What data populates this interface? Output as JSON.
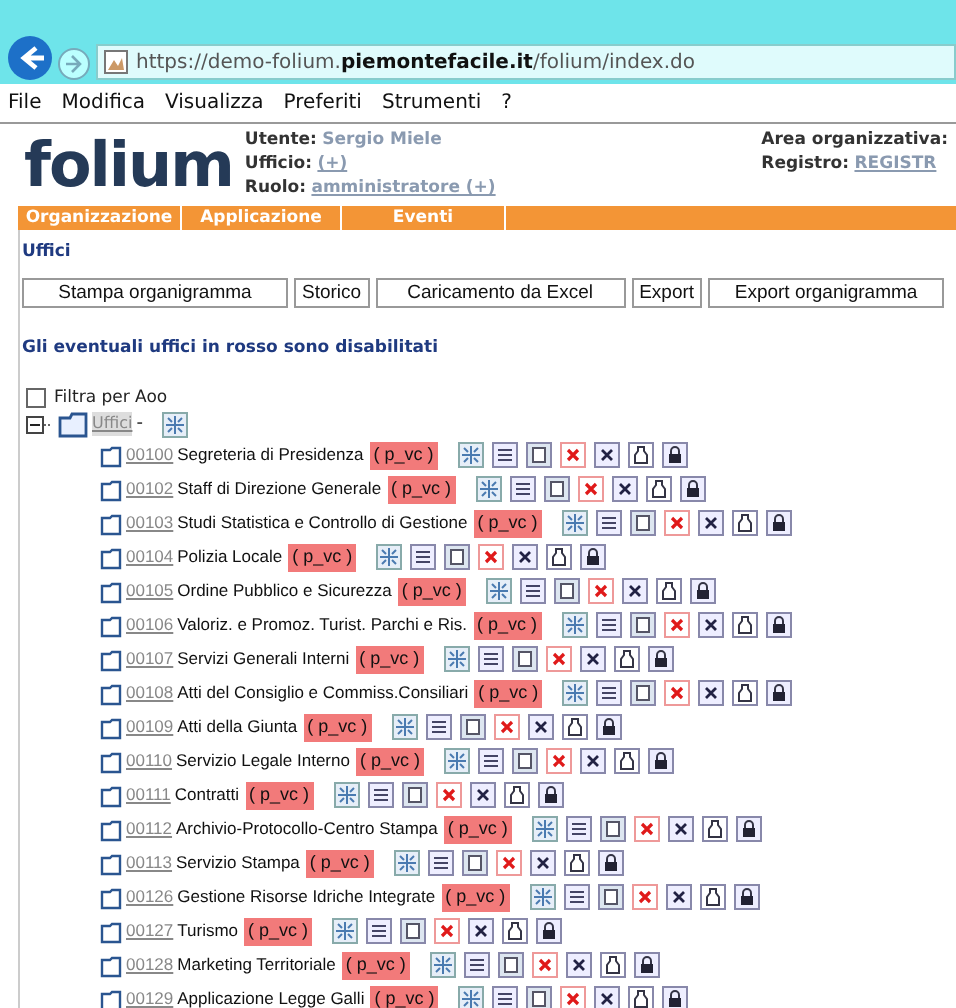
{
  "browser": {
    "url_prefix": "https://demo-folium.",
    "url_domain": "piemontefacile.it",
    "url_path": "/folium/index.do"
  },
  "menu": [
    "File",
    "Modifica",
    "Visualizza",
    "Preferiti",
    "Strumenti",
    "?"
  ],
  "header": {
    "logo": "folium",
    "user_label": "Utente:",
    "user": "Sergio Miele",
    "office_label": "Ufficio:",
    "office": "(+)",
    "role_label": "Ruolo:",
    "role": "amministratore (+)",
    "area_label": "Area organizzativa:",
    "registry_label": "Registro:",
    "registry": "REGISTR"
  },
  "nav": [
    "Organizzazione",
    "Applicazione",
    "Eventi"
  ],
  "section_title": "Uffici",
  "buttons": [
    "Stampa organigramma",
    "Storico",
    "Caricamento da Excel",
    "Export",
    "Export organigramma"
  ],
  "notice": "Gli eventuali uffici in **rosso** sono disabilitati",
  "filter": {
    "label": "Filtra per Aoo",
    "checked": false
  },
  "tree": {
    "label": "Uffici",
    "suffix": "-",
    "expanded": true,
    "children": [
      {
        "code": "00100",
        "name": "Segreteria di Presidenza",
        "tag": "( p_vc )"
      },
      {
        "code": "00102",
        "name": "Staff di Direzione Generale",
        "tag": "( p_vc )"
      },
      {
        "code": "00103",
        "name": "Studi Statistica e Controllo di Gestione",
        "tag": "( p_vc )"
      },
      {
        "code": "00104",
        "name": "Polizia Locale",
        "tag": "( p_vc )"
      },
      {
        "code": "00105",
        "name": "Ordine Pubblico e Sicurezza",
        "tag": "( p_vc )"
      },
      {
        "code": "00106",
        "name": "Valoriz. e Promoz. Turist. Parchi e Ris.",
        "tag": "( p_vc )"
      },
      {
        "code": "00107",
        "name": "Servizi Generali Interni",
        "tag": "( p_vc )"
      },
      {
        "code": "00108",
        "name": "Atti del Consiglio e Commiss.Consiliari",
        "tag": "( p_vc )"
      },
      {
        "code": "00109",
        "name": "Atti della Giunta",
        "tag": "( p_vc )"
      },
      {
        "code": "00110",
        "name": "Servizio Legale Interno",
        "tag": "( p_vc )"
      },
      {
        "code": "00111",
        "name": "Contratti",
        "tag": "( p_vc )"
      },
      {
        "code": "00112",
        "name": "Archivio-Protocollo-Centro Stampa",
        "tag": "( p_vc )"
      },
      {
        "code": "00113",
        "name": "Servizio Stampa",
        "tag": "( p_vc )"
      },
      {
        "code": "00126",
        "name": "Gestione Risorse Idriche Integrate",
        "tag": "( p_vc )"
      },
      {
        "code": "00127",
        "name": "Turismo",
        "tag": "( p_vc )"
      },
      {
        "code": "00128",
        "name": "Marketing Territoriale",
        "tag": "( p_vc )"
      },
      {
        "code": "00129",
        "name": "Applicazione Legge Galli",
        "tag": "( p_vc )"
      }
    ]
  }
}
